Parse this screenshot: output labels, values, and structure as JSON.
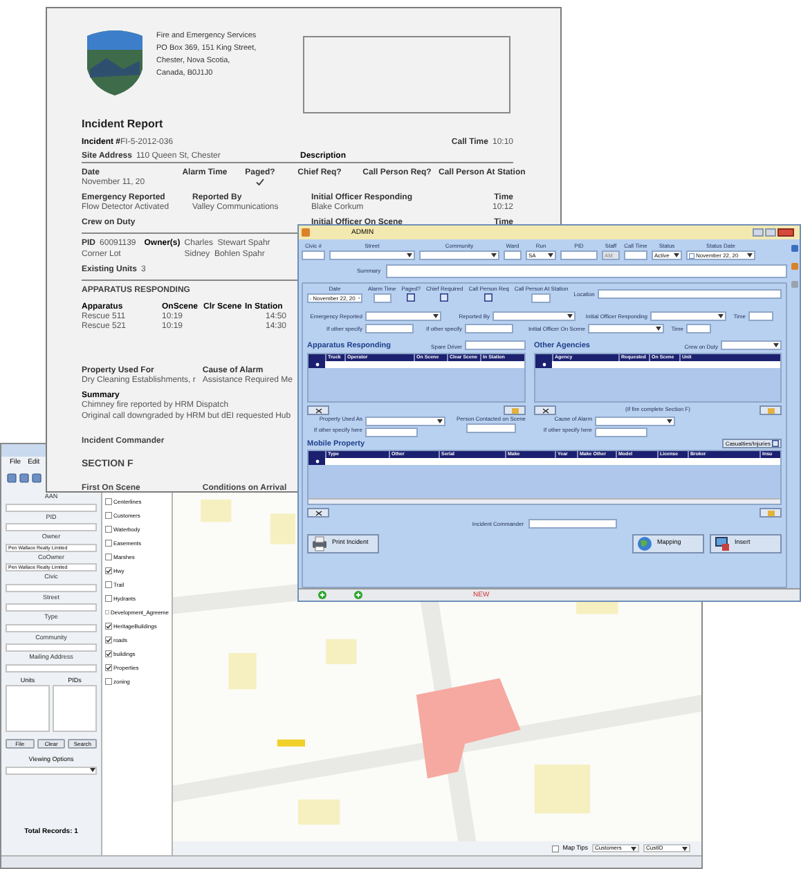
{
  "map_window": {
    "menu": [
      "File",
      "Edit"
    ],
    "search_panel": {
      "fields": [
        {
          "label": "AAN"
        },
        {
          "label": "PID"
        },
        {
          "label": "Owner",
          "value": "Pen Wallace Realty Limited"
        },
        {
          "label": "CoOwner",
          "value": "Pen Wallace Realty Limited"
        },
        {
          "label": "Civic"
        },
        {
          "label": "Street"
        },
        {
          "label": "Type"
        },
        {
          "label": "Community"
        },
        {
          "label": "Mailing Address"
        }
      ],
      "lists": [
        "Units",
        "PIDs"
      ],
      "buttons": [
        "File",
        "Clear",
        "Search"
      ],
      "viewing_options": "Viewing Options",
      "total": "Total Records: 1"
    },
    "legend": [
      {
        "label": "Centerlines",
        "checked": false
      },
      {
        "label": "Customers",
        "checked": false
      },
      {
        "label": "Waterbody",
        "checked": false
      },
      {
        "label": "Easements",
        "checked": false
      },
      {
        "label": "Marshes",
        "checked": false
      },
      {
        "label": "Hwy",
        "checked": true
      },
      {
        "label": "Trail",
        "checked": false
      },
      {
        "label": "Hydrants",
        "checked": false
      },
      {
        "label": "Development_Agreeme",
        "checked": false
      },
      {
        "label": "HeritageBuildings",
        "checked": true
      },
      {
        "label": "roads",
        "checked": true
      },
      {
        "label": "buildings",
        "checked": true
      },
      {
        "label": "Properties",
        "checked": true
      },
      {
        "label": "zoning",
        "checked": false
      }
    ],
    "map_toolbar": {
      "map_tips": "Map Tips",
      "map_tips_checked": false,
      "layer": "Customers",
      "field": "CustID"
    }
  },
  "report": {
    "org": [
      "Fire and Emergency Services",
      "PO Box 369, 151 King Street,",
      "Chester, Nova Scotia,",
      "Canada, B0J1J0"
    ],
    "title": "Incident Report",
    "incident": {
      "label": "Incident #",
      "value": "FI-5-2012-036"
    },
    "call_time": {
      "label": "Call Time",
      "value": "10:10"
    },
    "site": {
      "label": "Site Address",
      "value": "110 Queen St, Chester"
    },
    "description_label": "Description",
    "row1": [
      {
        "label": "Date",
        "value": "November 11, 20",
        "checked": false
      },
      {
        "label": "Alarm Time",
        "checked": false
      },
      {
        "label": "Paged?",
        "checked": true
      },
      {
        "label": "Chief Req?",
        "checked": false
      },
      {
        "label": "Call Person Req?",
        "checked": false
      },
      {
        "label": "Call Person At Station",
        "checked": false
      }
    ],
    "row2": [
      {
        "label": "Emergency Reported",
        "value": "Flow Detector Activated"
      },
      {
        "label": "Reported By",
        "value": "Valley Communications"
      },
      {
        "label": "Initial Officer Responding",
        "value": "Blake Corkum"
      },
      {
        "label": "Time",
        "value": "10:12"
      }
    ],
    "row3": [
      {
        "label": "Crew on Duty"
      },
      {
        "label": "Initial Officer On Scene"
      },
      {
        "label": "Time"
      }
    ],
    "pid": {
      "label": "PID",
      "value": "60091139"
    },
    "owners_label": "Owner(s)",
    "owners": [
      "Charles  Stewart Spahr",
      "Sidney  Bohlen Spahr"
    ],
    "corner": "Corner Lot",
    "units": {
      "label": "Existing Units",
      "value": "3"
    },
    "apparatus_heading": "APPARATUS RESPONDING",
    "apparatus_columns": [
      "Apparatus",
      "OnScene",
      "Clr Scene",
      "In Station"
    ],
    "apparatus": [
      {
        "name": "Rescue 511",
        "on_scene": "10:19",
        "in_station": "14:50"
      },
      {
        "name": "Rescue 521",
        "on_scene": "10:19",
        "in_station": "14:30"
      }
    ],
    "property": [
      {
        "label": "Property Used For",
        "value": "Dry Cleaning Establishments, r"
      },
      {
        "label": "Cause of Alarm",
        "value": "Assistance Required Me"
      }
    ],
    "summary_label": "Summary",
    "summary": [
      "Chimney fire reported by HRM Dispatch",
      "Original call downgraded by HRM but dEI requested Hub"
    ],
    "commander": "Incident Commander",
    "section": "SECTION F",
    "section_cols": [
      "First On Scene",
      "Conditions on Arrival"
    ]
  },
  "admin": {
    "title": "ADMIN",
    "top_fields": [
      {
        "label": "Civic #",
        "kind": "text",
        "disabled": false
      },
      {
        "label": "Street",
        "kind": "dropdown",
        "disabled": false
      },
      {
        "label": "Community",
        "kind": "dropdown",
        "disabled": false
      },
      {
        "label": "Ward",
        "kind": "text",
        "disabled": false
      },
      {
        "label": "Run",
        "kind": "dropdown",
        "value": "SA",
        "disabled": false
      },
      {
        "label": "PID",
        "kind": "text",
        "disabled": false
      },
      {
        "label": "Staff",
        "kind": "text",
        "value": "AM",
        "disabled": true
      },
      {
        "label": "Call Time",
        "kind": "text",
        "disabled": false
      },
      {
        "label": "Status",
        "kind": "dropdown",
        "value": "Active",
        "disabled": false
      },
      {
        "label": "Status Date",
        "kind": "date",
        "value": "November 22, 20",
        "checked": false,
        "disabled": false
      }
    ],
    "summary_label": "Summary",
    "incident_fields": [
      {
        "label": "Date",
        "kind": "date",
        "value": "November 22, 20",
        "checked": true
      },
      {
        "label": "Alarm Time",
        "kind": "text"
      },
      {
        "label": "Paged?",
        "kind": "checkbox",
        "checked": false
      },
      {
        "label": "Chief Required",
        "kind": "checkbox",
        "checked": false
      },
      {
        "label": "Call Person Req",
        "kind": "checkbox",
        "checked": false
      },
      {
        "label": "Call Person At Station",
        "kind": "text"
      }
    ],
    "location_label": "Location",
    "report_rows": [
      [
        {
          "label": "Emergency Reported",
          "kind": "dropdown"
        },
        {
          "label": "Reported By",
          "kind": "dropdown"
        },
        {
          "label": "Initial Officer Responding",
          "kind": "dropdown"
        },
        {
          "label": "Time",
          "kind": "text"
        }
      ],
      [
        {
          "label": "If other specify",
          "kind": "text"
        },
        {
          "label": "If other specify",
          "kind": "text"
        },
        {
          "label": "Initial Officer On Scene",
          "kind": "dropdown"
        },
        {
          "label": "Time",
          "kind": "text"
        }
      ]
    ],
    "apparatus": {
      "title": "Apparatus Responding",
      "extra_label": "Spare Driver",
      "columns": [
        "Truck",
        "Operator",
        "On Scene",
        "Clear Scene",
        "In Station"
      ]
    },
    "agencies": {
      "title": "Other Agencies",
      "extra_label": "Crew on Duty",
      "columns": [
        "Agency",
        "Requested",
        "On Scene",
        "Unit"
      ]
    },
    "section_note": "(If fire complete Section F)",
    "property_label": "Property Used As",
    "property_other": "If other specify here",
    "person_label": "Person Contacted on Scene",
    "cause_label": "Cause of Alarm",
    "cause_other": "If other specify here",
    "mobile": {
      "title": "Mobile Property",
      "casualties": "Casualties/Injuries",
      "casualties_checked": false,
      "columns": [
        "Type",
        "Other",
        "Serial",
        "Make",
        "Year",
        "Make Other",
        "Model",
        "License",
        "Broker",
        "Insu"
      ]
    },
    "commander_label": "Incident Commander",
    "buttons": [
      "Print Incident",
      "Mapping",
      "Insert"
    ],
    "status": "NEW"
  }
}
